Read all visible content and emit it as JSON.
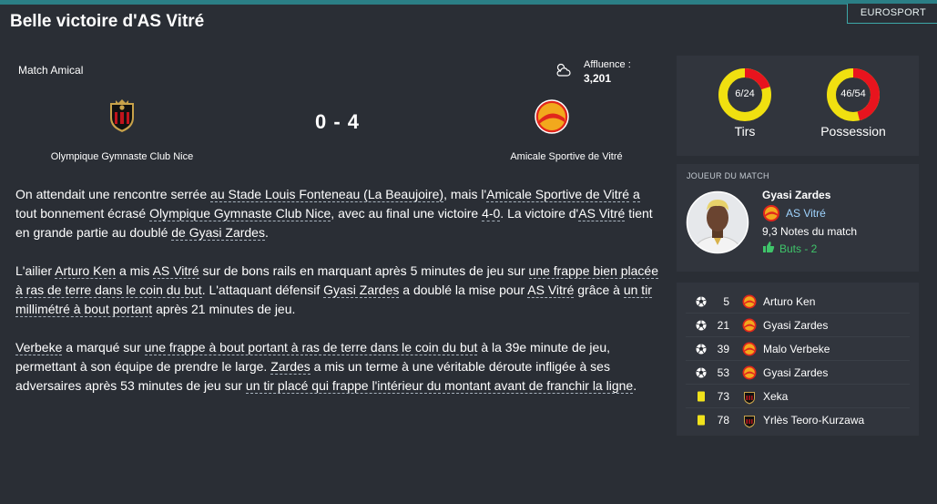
{
  "header": {
    "headline": "Belle victoire d'AS Vitré",
    "source_tag": "EUROSPORT"
  },
  "match": {
    "competition": "Match Amical",
    "weather_icon": "cloud-icon",
    "attendance_label": "Affluence :",
    "attendance_value": "3,201",
    "home_team": "Olympique Gymnaste Club Nice",
    "away_team": "Amicale Sportive de Vitré",
    "score": "0 - 4"
  },
  "article": {
    "p1": [
      "On attendait une rencontre serrée ",
      "au Stade Louis Fonteneau (La Beaujoire)",
      ", mais l'",
      "Amicale Sportive de Vitré",
      " ",
      "a",
      " tout bonnement écrasé ",
      "Olympique Gymnaste Club Nice",
      ", avec au final une victoire ",
      "4-0",
      ". La victoire d'",
      "AS Vitré",
      " tient en grande partie au doublé ",
      "de Gyasi Zardes",
      "."
    ],
    "p2": [
      "L'ailier ",
      "Arturo Ken",
      " a mis ",
      "AS Vitré",
      " sur de bons rails en marquant après 5 minutes de jeu sur ",
      "une frappe bien placée à ras de terre dans le coin du but",
      ". L'attaquant défensif ",
      "Gyasi Zardes",
      " a doublé la mise pour ",
      "AS Vitré",
      " grâce à ",
      "un tir millimétré à bout portant",
      " après 21 minutes de jeu."
    ],
    "p3": [
      "Verbeke",
      " a marqué sur ",
      "une frappe à bout portant à ras de terre dans le coin du but",
      " à la 39e minute de jeu, permettant à son équipe de prendre le large. ",
      "Zardes",
      " a mis un terme à une véritable déroute infligée à ses adversaires après 53 minutes de jeu sur ",
      "un tir placé qui frappe l'intérieur du montant avant de franchir la ligne",
      "."
    ]
  },
  "stats": {
    "shots": {
      "value": "6/24",
      "label": "Tirs",
      "home": 6,
      "away": 24
    },
    "possession": {
      "value": "46/54",
      "label": "Possession",
      "home": 46,
      "away": 54
    },
    "colors": {
      "home": "#e8141e",
      "away": "#f0e010"
    }
  },
  "motm": {
    "title": "JOUEUR DU MATCH",
    "name": "Gyasi Zardes",
    "club": "AS Vitré",
    "rating": "9,3 Notes du match",
    "goals": "Buts - 2"
  },
  "events": [
    {
      "type": "goal",
      "icon": "ball-icon",
      "minute": "5",
      "team": "vitre",
      "player": "Arturo Ken"
    },
    {
      "type": "goal",
      "icon": "ball-icon",
      "minute": "21",
      "team": "vitre",
      "player": "Gyasi Zardes"
    },
    {
      "type": "goal",
      "icon": "ball-icon",
      "minute": "39",
      "team": "vitre",
      "player": "Malo Verbeke"
    },
    {
      "type": "goal",
      "icon": "ball-icon",
      "minute": "53",
      "team": "vitre",
      "player": "Gyasi Zardes"
    },
    {
      "type": "yellow",
      "icon": "yellow-card-icon",
      "minute": "73",
      "team": "nice",
      "player": "Xeka"
    },
    {
      "type": "yellow",
      "icon": "yellow-card-icon",
      "minute": "78",
      "team": "nice",
      "player": "Yrlès Teoro-Kurzawa"
    }
  ]
}
